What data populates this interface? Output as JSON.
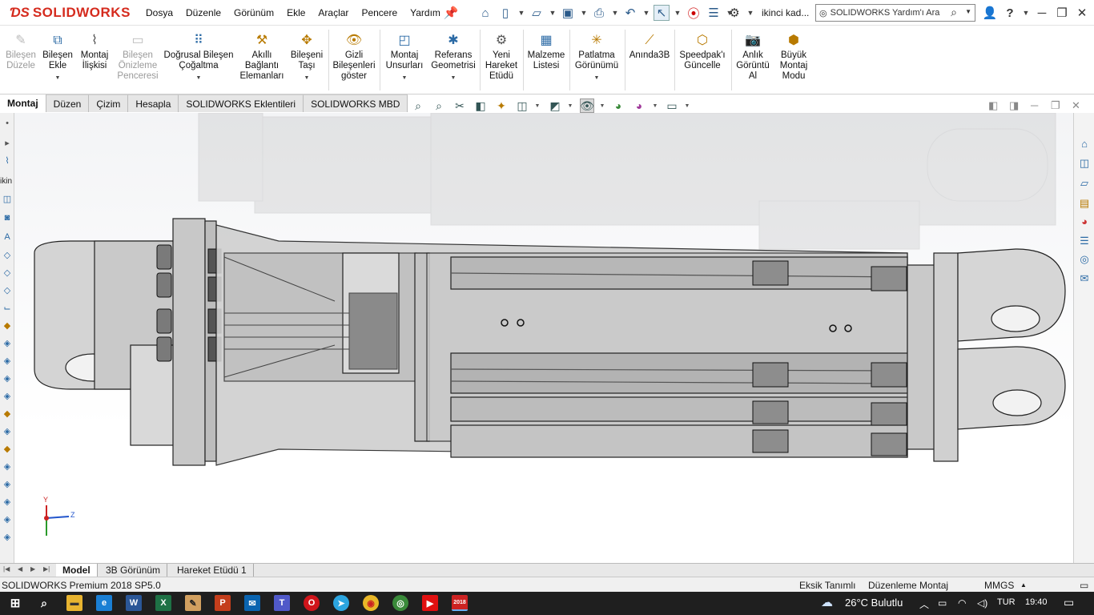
{
  "app": {
    "logo_ds": "ƊS",
    "logo_text": "SOLIDWORKS"
  },
  "menu": [
    "Dosya",
    "Düzenle",
    "Görünüm",
    "Ekle",
    "Araçlar",
    "Pencere",
    "Yardım"
  ],
  "user": {
    "name": "ikinci kad..."
  },
  "search": {
    "placeholder": "SOLIDWORKS Yardım'ı Ara"
  },
  "ribbon": {
    "edit_component": "Bileşen Düzele",
    "insert_component": "Bileşen Ekle",
    "mate": "Montaj İlişkisi",
    "component_preview": "Bileşen Önizleme Penceresi",
    "linear_pattern": "Doğrusal Bileşen Çoğaltma",
    "smart_fasteners": "Akıllı Bağlantı Elemanları",
    "move_component": "Bileşeni Taşı",
    "show_hidden": "Gizli Bileşenleri göster",
    "assembly_features": "Montaj Unsurları",
    "reference_geometry": "Referans Geometrisi",
    "new_motion_study": "Yeni Hareket Etüdü",
    "bom": "Malzeme Listesi",
    "exploded_view": "Patlatma Görünümü",
    "instant3d": "Anında3B",
    "update_speedpak": "Speedpak'ı Güncelle",
    "take_snapshot": "Anlık Görüntü Al",
    "large_assembly": "Büyük Montaj Modu"
  },
  "command_tabs": [
    "Montaj",
    "Düzen",
    "Çizim",
    "Hesapla",
    "SOLIDWORKS Eklentileri",
    "SOLIDWORKS MBD"
  ],
  "left_strip": {
    "label": "ikin"
  },
  "triad": {
    "y": "Y",
    "z": "Z"
  },
  "bottom_tabs": [
    "Model",
    "3B Görünüm",
    "Hareket Etüdü 1"
  ],
  "status": {
    "product": "SOLIDWORKS Premium 2018 SP5.0",
    "definition": "Eksik Tanımlı",
    "mode": "Düzenleme Montaj",
    "units": "MMGS",
    "units_arrow": "▲"
  },
  "taskbar": {
    "weather": "26°C  Bulutlu",
    "lang": "TUR",
    "time": "19:40",
    "sw_badge": "2018"
  },
  "colors": {
    "accent": "#d52b1e",
    "taskbar": "#1f1f1f",
    "ribbon_icon": "#2b6aa5"
  }
}
